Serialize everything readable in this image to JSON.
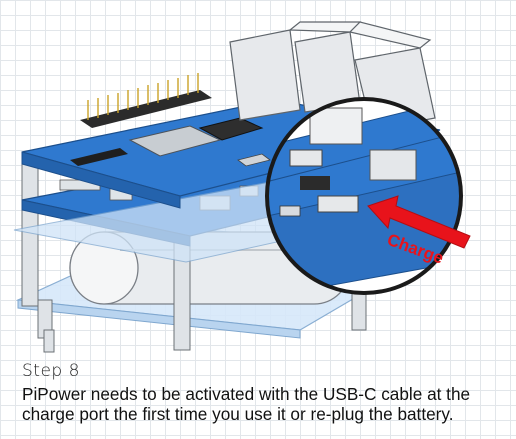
{
  "illustration": {
    "callout_label": "Charge",
    "colors": {
      "pcb_blue": "#2f79cf",
      "acrylic": "#cfe3f7",
      "callout_red": "#e8131b"
    }
  },
  "step": {
    "title": "Step 8",
    "caption": "PiPower needs to be activated with the USB-C cable at the charge port the first time you use it or re-plug the battery."
  }
}
